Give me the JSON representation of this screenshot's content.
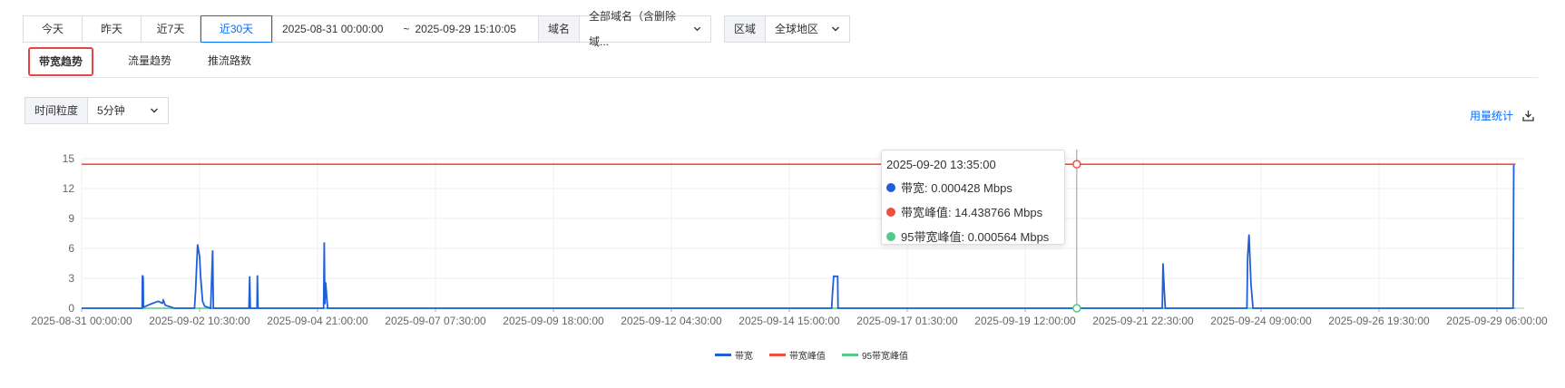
{
  "toolbar": {
    "quick_ranges": [
      "今天",
      "昨天",
      "近7天",
      "近30天"
    ],
    "active_range_index": 3,
    "date_start": "2025-08-31 00:00:00",
    "date_sep": "~",
    "date_end": "2025-09-29 15:10:05",
    "calendar_icon": "calendar-icon"
  },
  "domain_filter": {
    "label": "域名",
    "value": "全部域名（含删除域..."
  },
  "region_filter": {
    "label": "区域",
    "value": "全球地区"
  },
  "tabs": [
    {
      "label": "带宽趋势",
      "active": true
    },
    {
      "label": "流量趋势",
      "active": false
    },
    {
      "label": "推流路数",
      "active": false
    }
  ],
  "granularity": {
    "label": "时间粒度",
    "value": "5分钟"
  },
  "usage_link": {
    "label": "用量统计",
    "icon": "download-icon"
  },
  "colors": {
    "accent": "#006eff",
    "bandwidth": "#1f5fd8",
    "peak": "#f04f3f",
    "p95": "#53c98a",
    "highlight_border": "#e54545"
  },
  "tooltip": {
    "time": "2025-09-20 13:35:00",
    "rows": [
      {
        "label": "带宽: 0.000428 Mbps",
        "color": "#1f5fd8"
      },
      {
        "label": "带宽峰值: 14.438766 Mbps",
        "color": "#f04f3f"
      },
      {
        "label": "95带宽峰值: 0.000564 Mbps",
        "color": "#53c98a"
      }
    ]
  },
  "chart_data": {
    "type": "line",
    "title": "",
    "xlabel": "",
    "ylabel": "",
    "ylim": [
      0,
      15
    ],
    "yticks": [
      0,
      3,
      6,
      9,
      12,
      15
    ],
    "x_range": [
      "2025-08-31 00:00:00",
      "2025-09-29 15:10:00"
    ],
    "xticks": [
      "2025-08-31 00:00:00",
      "2025-09-02 10:30:00",
      "2025-09-04 21:00:00",
      "2025-09-07 07:30:00",
      "2025-09-09 18:00:00",
      "2025-09-12 04:30:00",
      "2025-09-14 15:00:00",
      "2025-09-17 01:30:00",
      "2025-09-19 12:00:00",
      "2025-09-21 22:30:00",
      "2025-09-24 09:00:00",
      "2025-09-26 19:30:00",
      "2025-09-29 06:00:00"
    ],
    "grid": true,
    "legend": "bottom",
    "series": [
      {
        "name": "带宽",
        "points": [
          [
            "2025-08-31 00:00",
            0
          ],
          [
            "2025-09-01 06:00",
            0
          ],
          [
            "2025-09-01 06:10",
            3.3
          ],
          [
            "2025-09-01 06:30",
            3.1
          ],
          [
            "2025-09-01 06:40",
            0.1
          ],
          [
            "2025-09-01 10:00",
            0.4
          ],
          [
            "2025-09-01 14:00",
            0.7
          ],
          [
            "2025-09-01 16:00",
            0.5
          ],
          [
            "2025-09-01 16:30",
            0.8
          ],
          [
            "2025-09-01 17:30",
            0.3
          ],
          [
            "2025-09-01 22:00",
            0
          ],
          [
            "2025-09-02 08:00",
            0
          ],
          [
            "2025-09-02 08:30",
            1.8
          ],
          [
            "2025-09-02 09:30",
            6.4
          ],
          [
            "2025-09-02 10:30",
            5.2
          ],
          [
            "2025-09-02 11:00",
            3.2
          ],
          [
            "2025-09-02 12:00",
            0.7
          ],
          [
            "2025-09-02 13:00",
            0.2
          ],
          [
            "2025-09-02 16:00",
            0
          ],
          [
            "2025-09-02 17:00",
            5.8
          ],
          [
            "2025-09-02 17:20",
            0
          ],
          [
            "2025-09-03 11:00",
            0
          ],
          [
            "2025-09-03 11:20",
            3.2
          ],
          [
            "2025-09-03 11:40",
            0
          ],
          [
            "2025-09-03 15:00",
            0
          ],
          [
            "2025-09-03 15:10",
            3.3
          ],
          [
            "2025-09-03 15:30",
            0
          ],
          [
            "2025-09-05 00:00",
            0
          ],
          [
            "2025-09-05 00:20",
            6.6
          ],
          [
            "2025-09-05 00:40",
            0.4
          ],
          [
            "2025-09-05 01:00",
            2.6
          ],
          [
            "2025-09-05 02:00",
            0
          ],
          [
            "2025-09-15 12:00",
            0
          ],
          [
            "2025-09-15 12:20",
            1.2
          ],
          [
            "2025-09-15 13:00",
            3.2
          ],
          [
            "2025-09-15 15:00",
            3.2
          ],
          [
            "2025-09-15 15:10",
            0
          ],
          [
            "2025-09-22 08:00",
            0
          ],
          [
            "2025-09-22 08:20",
            4.5
          ],
          [
            "2025-09-22 09:00",
            1.8
          ],
          [
            "2025-09-22 09:30",
            0
          ],
          [
            "2025-09-24 02:00",
            0
          ],
          [
            "2025-09-24 02:20",
            5.1
          ],
          [
            "2025-09-24 03:00",
            7.4
          ],
          [
            "2025-09-24 04:00",
            2.4
          ],
          [
            "2025-09-24 05:00",
            0
          ],
          [
            "2025-09-29 14:00",
            0
          ],
          [
            "2025-09-29 14:20",
            14.4
          ]
        ]
      },
      {
        "name": "带宽峰值",
        "points": [
          [
            "2025-08-31 00:00",
            14.44
          ],
          [
            "2025-09-29 15:10",
            14.44
          ]
        ]
      },
      {
        "name": "95带宽峰值",
        "points": [
          [
            "2025-08-31 00:00",
            0.0006
          ],
          [
            "2025-09-29 15:10",
            0.0006
          ]
        ]
      }
    ],
    "cursor_time": "2025-09-20 13:35:00"
  }
}
